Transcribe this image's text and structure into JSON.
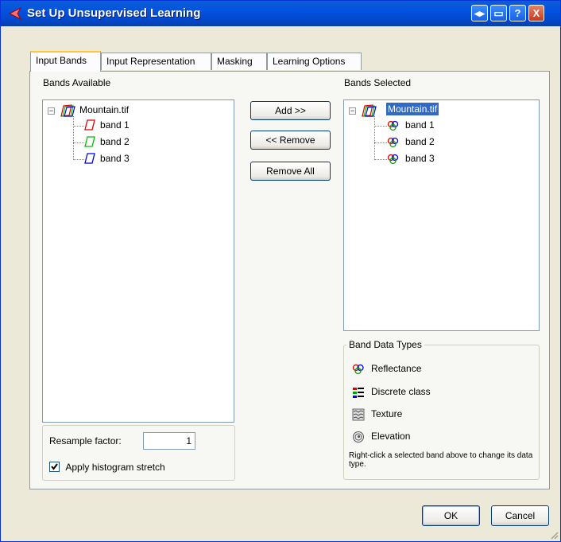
{
  "window": {
    "title": "Set Up Unsupervised Learning",
    "buttons": {
      "restore": "◂▸",
      "minimize": "▭",
      "help": "?",
      "close": "X"
    }
  },
  "tabs": [
    "Input Bands",
    "Input Representation",
    "Masking",
    "Learning Options"
  ],
  "left": {
    "header": "Bands Available",
    "root": "Mountain.tif",
    "bands": [
      {
        "label": "band 1",
        "color": "#e00000"
      },
      {
        "label": "band 2",
        "color": "#00c000"
      },
      {
        "label": "band 3",
        "color": "#0000e0"
      }
    ]
  },
  "middle": {
    "add": "Add >>",
    "remove": "<< Remove",
    "remove_all": "Remove All"
  },
  "right": {
    "header": "Bands Selected",
    "root": "Mountain.tif",
    "bands": [
      "band 1",
      "band 2",
      "band 3"
    ]
  },
  "resample": {
    "label": "Resample factor:",
    "value": "1",
    "histogram_label": "Apply histogram stretch",
    "histogram_checked": true
  },
  "band_data_types": {
    "title": "Band Data Types",
    "items": [
      {
        "label": "Reflectance",
        "icon": "reflectance-icon"
      },
      {
        "label": "Discrete class",
        "icon": "discrete-class-icon"
      },
      {
        "label": "Texture",
        "icon": "texture-icon"
      },
      {
        "label": "Elevation",
        "icon": "elevation-icon"
      }
    ],
    "hint": "Right-click a selected band above to change its data type."
  },
  "footer": {
    "ok": "OK",
    "cancel": "Cancel"
  }
}
